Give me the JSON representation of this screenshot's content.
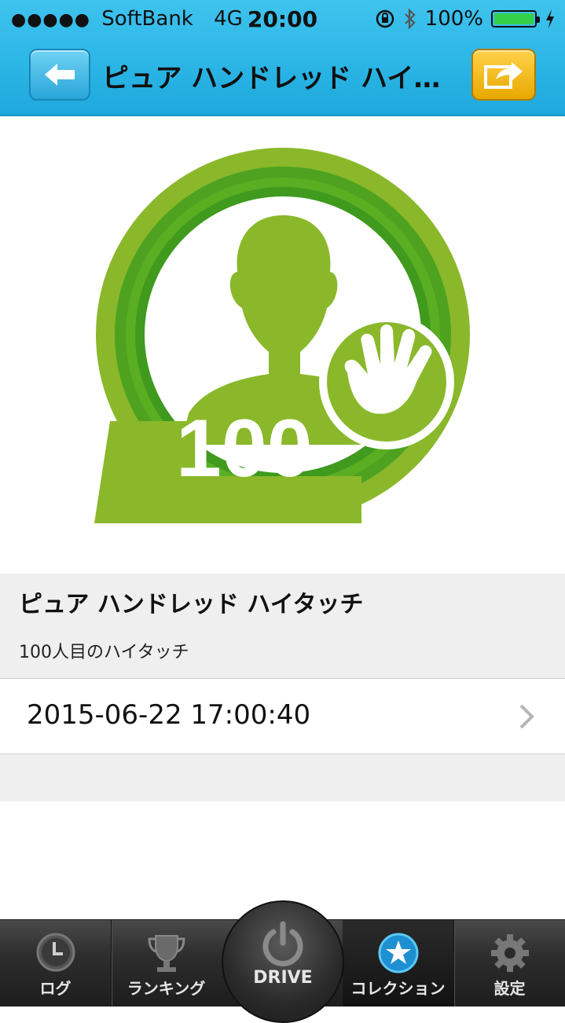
{
  "status_bar": {
    "signal_dots": "●●●●●",
    "carrier": "SoftBank",
    "network": "4G",
    "time": "20:00",
    "battery": "100%",
    "battery_level": 1.0
  },
  "navbar": {
    "title": "ピュア ハンドレッド ハイ…",
    "back_icon": "left-arrow-icon",
    "share_icon": "share-arrow-icon"
  },
  "badge": {
    "number": "100",
    "icon": "hand-icon",
    "colors": {
      "outer": "#8ab82a",
      "ring_dark": "#3f9a1e",
      "ring_mid": "#5aae22",
      "white": "#ffffff"
    }
  },
  "detail": {
    "name": "ピュア ハンドレッド ハイタッチ",
    "description": "100人目のハイタッチ",
    "date": "2015-06-22 17:00:40"
  },
  "tabbar": {
    "tabs": [
      {
        "label": "ログ",
        "icon": "clock-icon"
      },
      {
        "label": "ランキング",
        "icon": "trophy-icon"
      },
      {
        "label": "DRIVE",
        "icon": "power-icon"
      },
      {
        "label": "コレクション",
        "icon": "star-icon"
      },
      {
        "label": "設定",
        "icon": "gear-icon"
      }
    ],
    "active_index": 3
  }
}
